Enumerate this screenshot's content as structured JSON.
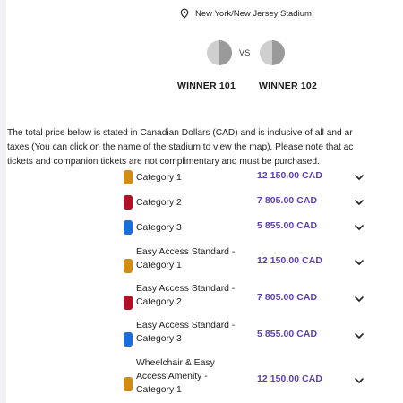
{
  "venue": {
    "name": "New York/New Jersey Stadium",
    "icon": "location-pin-icon"
  },
  "match": {
    "home_team": "WINNER 101",
    "away_team": "WINNER 102",
    "vs_label": "VS",
    "team_icon": "team-placeholder-icon"
  },
  "notice": {
    "line1": "The total price below is stated in Canadian Dollars (CAD) and is inclusive of all and ar",
    "line2": "taxes (You can click on the name of the stadium to view the map). Please note that ac",
    "line3": "tickets and companion tickets are not complimentary and must be purchased."
  },
  "colors": {
    "gold": "#d28c14",
    "red": "#b01027",
    "blue": "#1a6fd6",
    "price": "#5b3fb0"
  },
  "categories": [
    {
      "label_lines": [
        "Category 1"
      ],
      "price": "12 150.00 CAD",
      "color": "#d28c14"
    },
    {
      "label_lines": [
        "Category 2"
      ],
      "price": "7 805.00 CAD",
      "color": "#b01027"
    },
    {
      "label_lines": [
        "Category 3"
      ],
      "price": "5 855.00 CAD",
      "color": "#1a6fd6"
    },
    {
      "label_lines": [
        "Easy Access Standard -",
        "Category 1"
      ],
      "price": "12 150.00 CAD",
      "color": "#d28c14"
    },
    {
      "label_lines": [
        "Easy Access Standard -",
        "Category 2"
      ],
      "price": "7 805.00 CAD",
      "color": "#b01027"
    },
    {
      "label_lines": [
        "Easy Access Standard -",
        "Category 3"
      ],
      "price": "5 855.00 CAD",
      "color": "#1a6fd6"
    },
    {
      "label_lines": [
        "Wheelchair & Easy",
        "Access Amenity -",
        "Category 1"
      ],
      "price": "12 150.00 CAD",
      "color": "#d28c14"
    }
  ],
  "expand_icon": "chevron-down-icon"
}
